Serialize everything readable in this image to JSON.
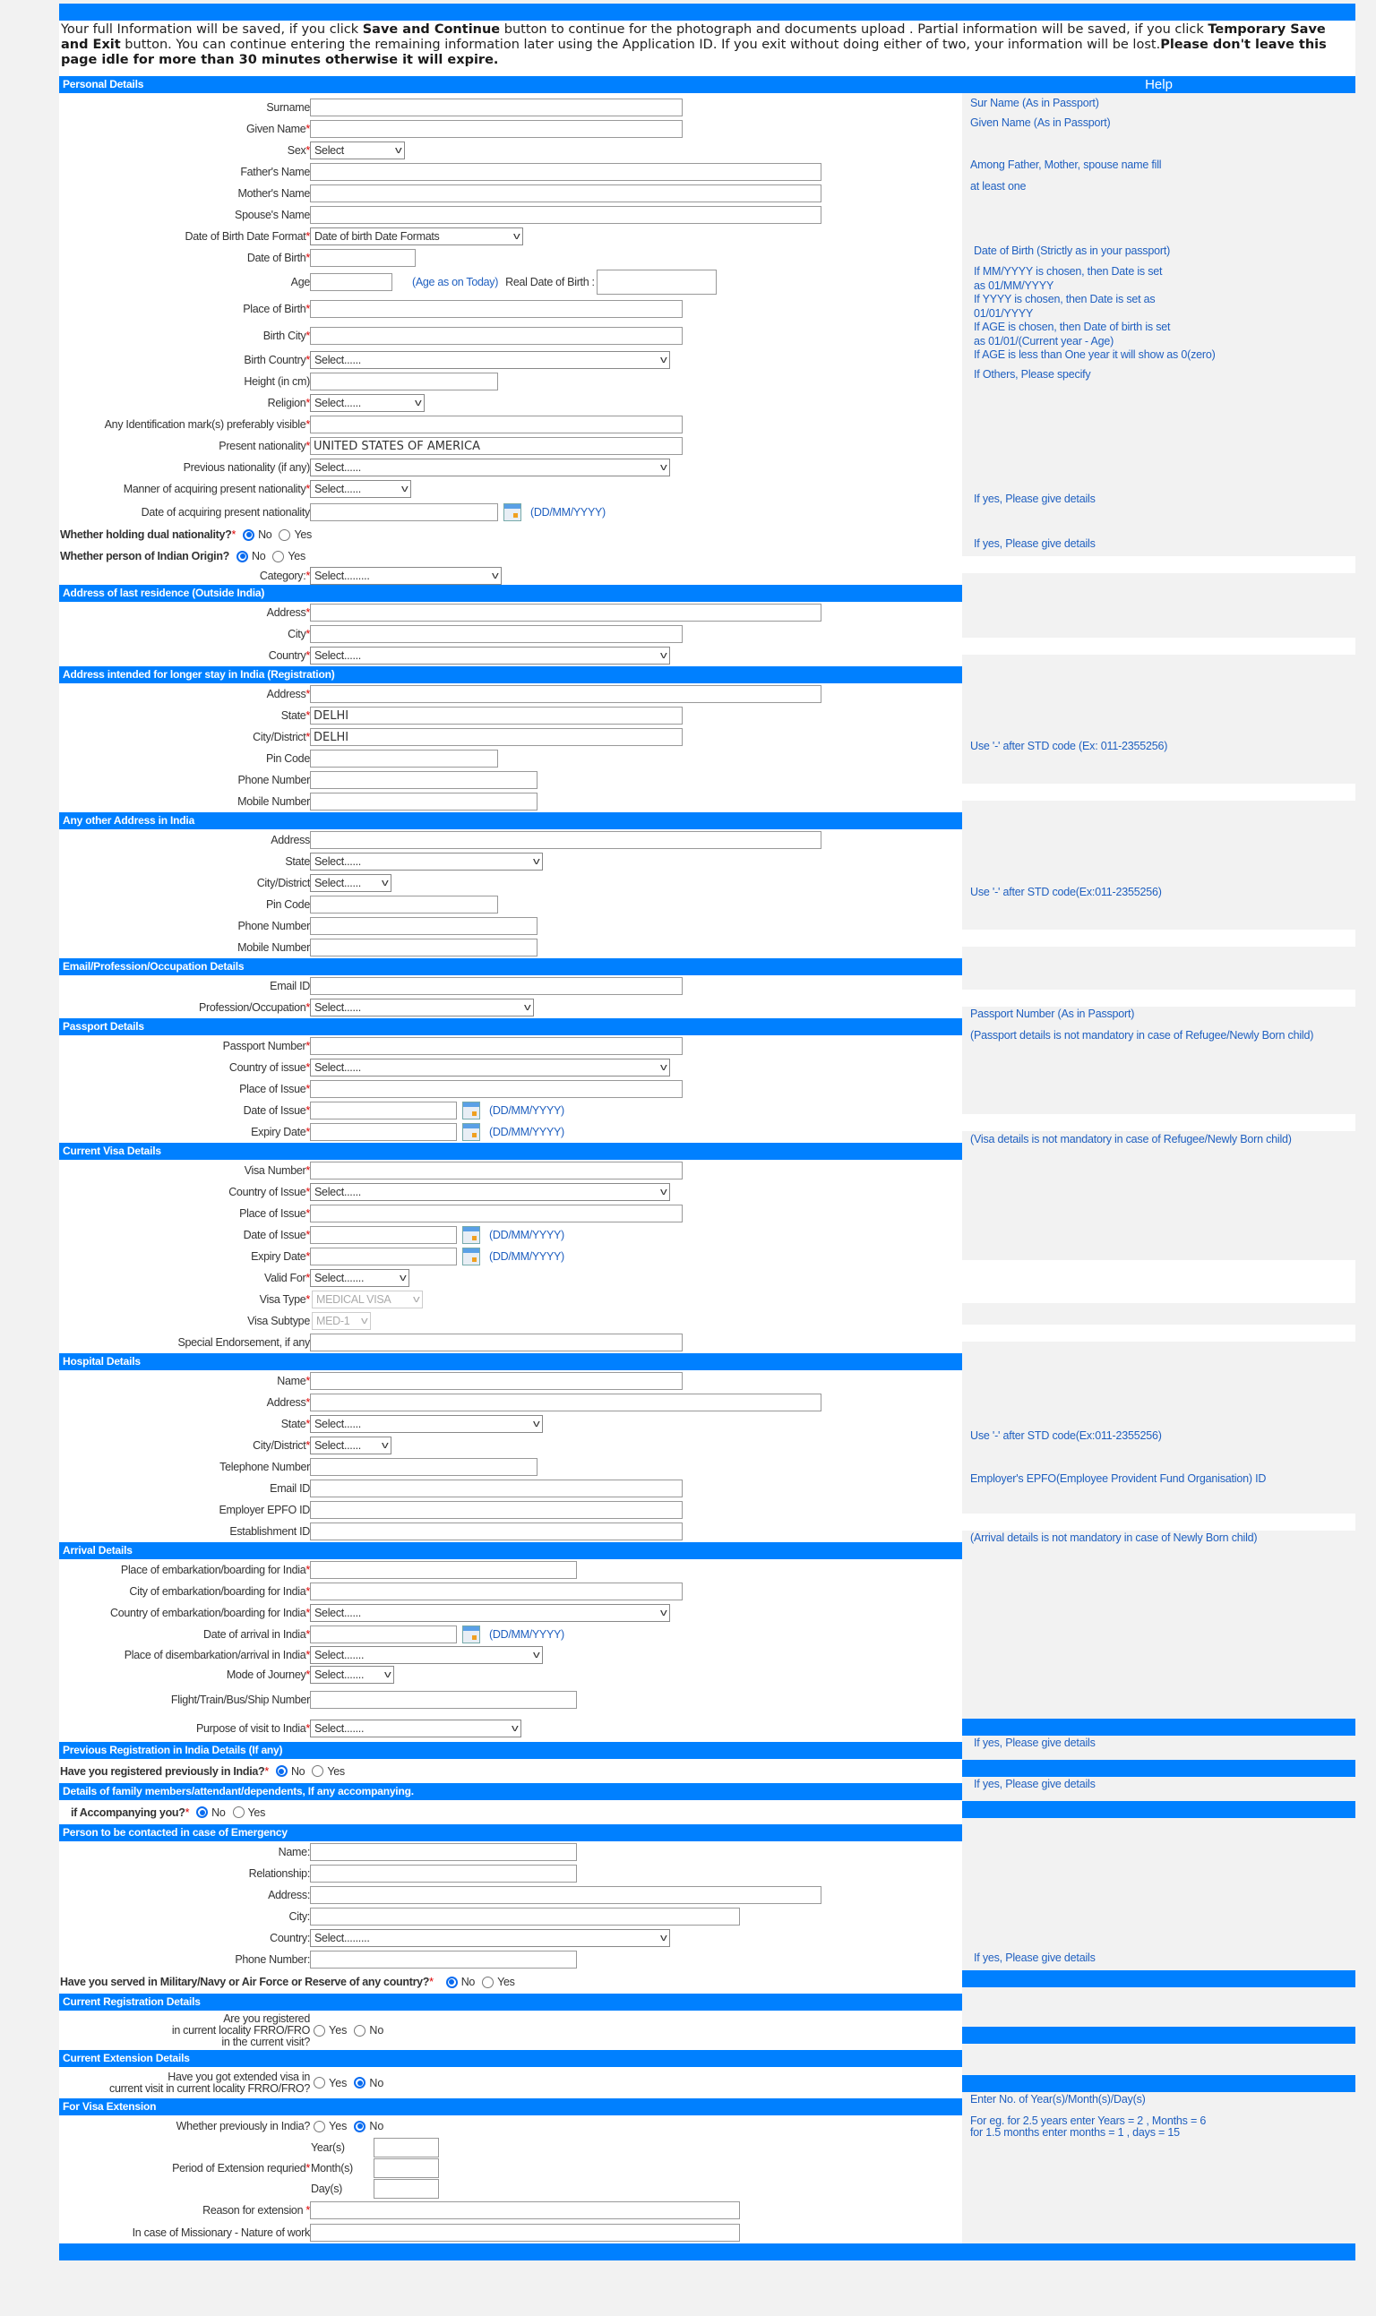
{
  "notice": {
    "p1": "Your full Information will be saved, if you click ",
    "b1": "Save and Continue",
    "p2": " button to continue for the photograph and documents upload . Partial information will be saved, if you click ",
    "b2": "Temporary Save and Exit",
    "p3": " button. You can continue entering the remaining information later using the Application ID. If you exit without doing either of two, your information will be lost.",
    "b3": "Please don't leave this page idle for more than 30 minutes otherwise it will expire."
  },
  "help_title": "Help",
  "date_format": "(DD/MM/YYYY)",
  "personal": {
    "title": "Personal Details",
    "surname": "Surname",
    "given_name": "Given Name",
    "sex": "Sex",
    "sex_value": "Select",
    "father": "Father's Name",
    "mother": "Mother's Name",
    "spouse": "Spouse's Name",
    "dob_format": "Date of Birth Date Format",
    "dob_format_value": "Date of birth Date Formats",
    "dob": "Date of Birth",
    "age": "Age",
    "age_note": "(Age as on Today)",
    "real_dob": "Real Date of Birth :",
    "place_of_birth": "Place of Birth",
    "birth_city": "Birth City",
    "birth_country": "Birth Country",
    "birth_country_value": "Select......",
    "height": "Height (in cm)",
    "religion": "Religion",
    "religion_value": "Select......",
    "ident_mark": "Any Identification mark(s) preferably visible",
    "present_nat": "Present nationality",
    "present_nat_value": "UNITED STATES OF AMERICA",
    "prev_nat": "Previous nationality (if any)",
    "prev_nat_value": "Select......",
    "manner_nat": "Manner of acquiring present nationality",
    "manner_nat_value": "Select......",
    "date_nat": "Date of acquiring present nationality",
    "dual_nat": "Whether holding dual nationality?",
    "indian_origin": "Whether person of Indian Origin?",
    "category": "Category:",
    "category_value": "Select........."
  },
  "radio": {
    "no": "No",
    "yes": "Yes"
  },
  "last_res": {
    "title": "Address of last residence (Outside India)",
    "address": "Address",
    "city": "City",
    "country": "Country",
    "country_value": "Select......"
  },
  "india_addr": {
    "title": "Address intended for longer stay in India (Registration)",
    "address": "Address",
    "state": "State",
    "state_value": "DELHI",
    "city": "City/District",
    "city_value": "DELHI",
    "pin": "Pin Code",
    "phone": "Phone Number",
    "mobile": "Mobile Number"
  },
  "other_addr": {
    "title": "Any other Address in India",
    "address": "Address",
    "state": "State",
    "state_value": "Select......",
    "city": "City/District",
    "city_value": "Select......",
    "pin": "Pin Code",
    "phone": "Phone Number",
    "mobile": "Mobile Number"
  },
  "email_prof": {
    "title": "Email/Profession/Occupation Details",
    "email": "Email ID",
    "profession": "Profession/Occupation",
    "profession_value": "Select......"
  },
  "passport": {
    "title": "Passport Details",
    "number": "Passport Number",
    "country": "Country of issue",
    "country_value": "Select......",
    "place": "Place of Issue",
    "issue_date": "Date of Issue",
    "expiry": "Expiry Date"
  },
  "visa": {
    "title": "Current Visa Details",
    "number": "Visa Number",
    "country": "Country of Issue",
    "country_value": "Select......",
    "place": "Place of Issue",
    "issue_date": "Date of Issue",
    "expiry": "Expiry Date",
    "valid_for": "Valid For",
    "valid_for_value": "Select.......",
    "type": "Visa Type",
    "type_value": "MEDICAL VISA",
    "subtype": "Visa Subtype",
    "subtype_value": "MED-1",
    "endorsement": "Special Endorsement, if any"
  },
  "hospital": {
    "title": "Hospital Details",
    "name": "Name",
    "address": "Address",
    "state": "State",
    "state_value": "Select......",
    "city": "City/District",
    "city_value": "Select......",
    "phone": "Telephone Number",
    "email": "Email ID",
    "epfo": "Employer EPFO ID",
    "establishment": "Establishment ID"
  },
  "arrival": {
    "title": "Arrival Details",
    "place_emb": "Place of embarkation/boarding for India",
    "city_emb": "City of embarkation/boarding for India",
    "country_emb": "Country of embarkation/boarding for India",
    "country_emb_value": "Select......",
    "date_arrival": "Date of arrival in India",
    "place_dis": "Place of disembarkation/arrival in India",
    "place_dis_value": "Select.......",
    "mode": "Mode of Journey",
    "mode_value": "Select.......",
    "flight": "Flight/Train/Bus/Ship Number",
    "purpose": "Purpose of visit to India",
    "purpose_value": "Select......."
  },
  "prev_reg": {
    "title": "Previous Registration in India Details (If any)",
    "question": "Have you registered previously in India?"
  },
  "family": {
    "title": "Details of family members/attendant/dependents, If any accompanying.",
    "question": "if Accompanying you?"
  },
  "emergency": {
    "title": "Person to be contacted in case of Emergency",
    "name": "Name:",
    "relationship": "Relationship:",
    "address": "Address:",
    "city": "City:",
    "country": "Country:",
    "country_value": "Select.........",
    "phone": "Phone Number:",
    "military": "Have you served in Military/Navy or Air Force or Reserve of any country?"
  },
  "cur_reg": {
    "title": "Current Registration Details",
    "q1": "Are you registered",
    "q2": "in current locality FRRO/FRO",
    "q3": "in the current visit?"
  },
  "cur_ext": {
    "title": "Current Extension Details",
    "q1": "Have you got extended visa in",
    "q2": "current visit in current locality FRRO/FRO?"
  },
  "visa_ext": {
    "title": "For Visa Extension",
    "prev_india": "Whether previously in India?",
    "period": "Period of Extension requried",
    "years": "Year(s)",
    "months": "Month(s)",
    "days": "Day(s)",
    "reason": "Reason for extension ",
    "missionary": "In case of Missionary - Nature of work"
  },
  "help": {
    "surname": "Sur Name (As in Passport)",
    "given": "Given Name (As in Passport)",
    "parents1": "Among Father, Mother, spouse name fill",
    "parents2": "at least one",
    "dob": "Date of Birth (Strictly as in your passport)",
    "dob_l1": "If MM/YYYY is chosen, then Date is set",
    "dob_l2": "as 01/MM/YYYY",
    "dob_l3": "If YYYY is chosen, then Date is set as",
    "dob_l4": "01/01/YYYY",
    "dob_l5": "If AGE is chosen, then Date of birth is set",
    "dob_l6": "as 01/01/(Current year - Age)",
    "dob_l7": "If AGE is less than One year it will show as 0(zero)",
    "religion": "If Others, Please specify",
    "if_yes": "If yes, Please give details",
    "std1": "Use '-' after STD code (Ex: 011-2355256)",
    "std2": "Use '-' after STD code(Ex:011-2355256)",
    "passport_no": "Passport Number (As in Passport)",
    "passport_note": "(Passport details is not mandatory in case of Refugee/Newly Born child)",
    "visa_note": "(Visa details is not mandatory in case of Refugee/Newly Born child)",
    "epfo": "Employer's EPFO(Employee Provident Fund Organisation) ID",
    "arrival_note": "(Arrival details is not mandatory in case of Newly Born child)",
    "ext1": "Enter No. of Year(s)/Month(s)/Day(s)",
    "ext2": "For eg. for 2.5 years enter Years = 2 , Months = 6",
    "ext3": "for 1.5 months enter months = 1 , days = 15"
  }
}
